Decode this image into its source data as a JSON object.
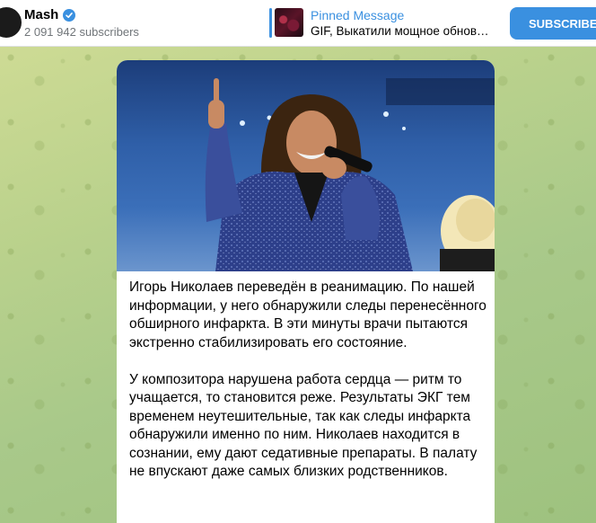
{
  "header": {
    "channel_name": "Mash",
    "subscribers": "2 091 942 subscribers",
    "pinned_title": "Pinned Message",
    "pinned_text": "GIF, Выкатили мощное обнов…",
    "subscribe_label": "SUBSCRIBE"
  },
  "post": {
    "paragraphs": [
      "Игорь Николаев переведён в реанимацию. По нашей информации, у него обнаружили следы перенесённого обширного инфаркта. В эти минуты врачи пытаются экстренно стабилизировать его состояние.",
      "У композитора нарушена работа сердца — ритм то учащается, то становится реже. Результаты ЭКГ тем временем неутешительные, так как следы инфаркта обнаружили именно по ним. Николаев находится в сознании, ему дают седативные препараты. В палату не впускают даже самых близких родственников."
    ]
  },
  "colors": {
    "accent": "#3a90e0",
    "background": "#b9d18c"
  },
  "icons": {
    "verified": "verified-badge-icon"
  }
}
